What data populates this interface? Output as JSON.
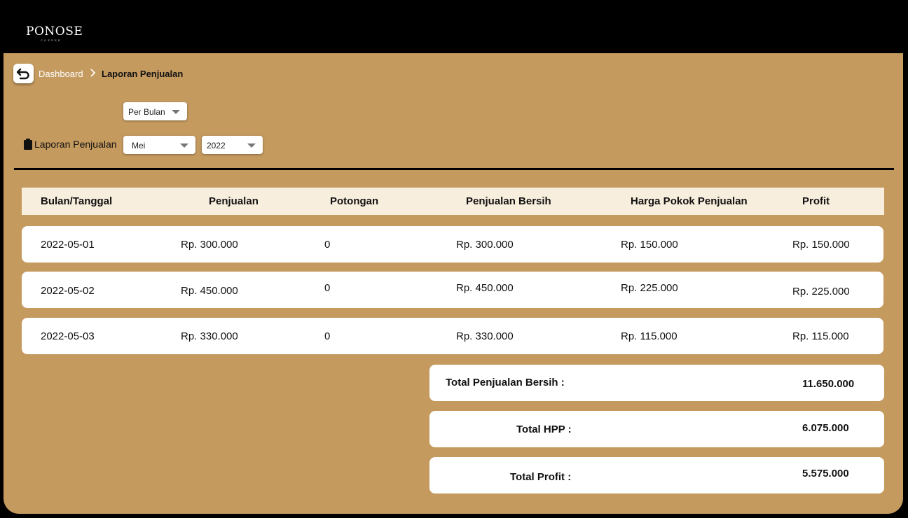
{
  "brand": {
    "name": "PONOSE",
    "sub": "COFFEE"
  },
  "breadcrumb": {
    "parent": "Dashboard",
    "current": "Laporan Penjualan"
  },
  "filters": {
    "period": "Per Bulan",
    "label": "Laporan Penjualan",
    "month": "Mei",
    "year": "2022"
  },
  "table": {
    "headers": [
      "Bulan/Tanggal",
      "Penjualan",
      "Potongan",
      "Penjualan Bersih",
      "Harga Pokok Penjualan",
      "Profit"
    ],
    "rows": [
      [
        "2022-05-01",
        "Rp. 300.000",
        "0",
        "Rp. 300.000",
        "Rp. 150.000",
        "Rp. 150.000"
      ],
      [
        "2022-05-02",
        "Rp. 450.000",
        "0",
        "Rp. 450.000",
        "Rp. 225.000",
        "Rp. 225.000"
      ],
      [
        "2022-05-03",
        "Rp. 330.000",
        "0",
        "Rp. 330.000",
        "Rp. 115.000",
        "Rp. 115.000"
      ]
    ]
  },
  "summary": {
    "net_sales_label": "Total Penjualan Bersih :",
    "net_sales_value": "11.650.000",
    "hpp_label": "Total HPP :",
    "hpp_value": "6.075.000",
    "profit_label": "Total Profit :",
    "profit_value": "5.575.000"
  },
  "colors": {
    "background": "#c59a5f",
    "header_row": "#f8eedd",
    "topbar": "#000000"
  }
}
